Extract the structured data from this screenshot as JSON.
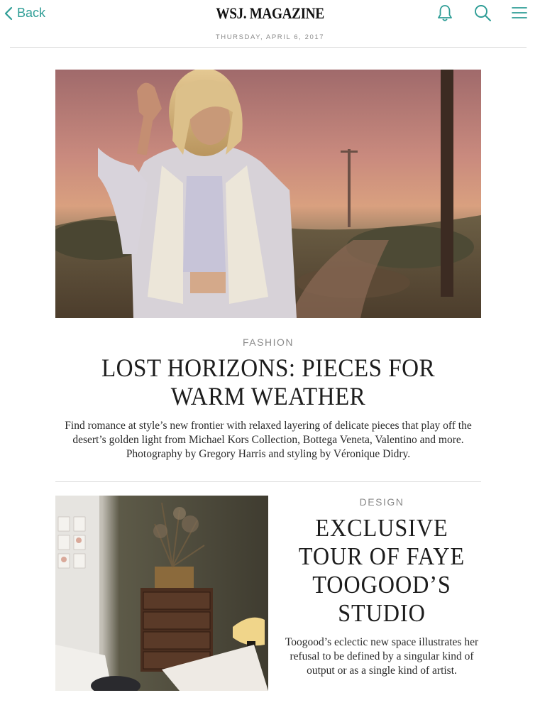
{
  "header": {
    "back_label": "Back",
    "logo": "WSJ. MAGAZINE",
    "date": "THURSDAY, APRIL 6, 2017",
    "accent_color": "#2e9d96"
  },
  "icons": {
    "back": "chevron-left-icon",
    "notifications": "bell-icon",
    "search": "search-icon",
    "menu": "hamburger-menu-icon"
  },
  "articles": [
    {
      "category": "FASHION",
      "title": "LOST HORIZONS: PIECES FOR WARM WEATHER",
      "dek": "Find romance at style’s new frontier with relaxed layering of delicate pieces that play off the desert’s golden light from Michael Kors Collection, Bottega Veneta, Valentino and more. Photography by Gregory Harris and styling by Véronique Didry."
    },
    {
      "category": "DESIGN",
      "title": "EXCLUSIVE TOUR OF FAYE TOOGOOD’S STUDIO",
      "dek": "Toogood’s eclectic new space illustrates her refusal to be defined by a singular kind of output or as a single kind of artist."
    }
  ]
}
